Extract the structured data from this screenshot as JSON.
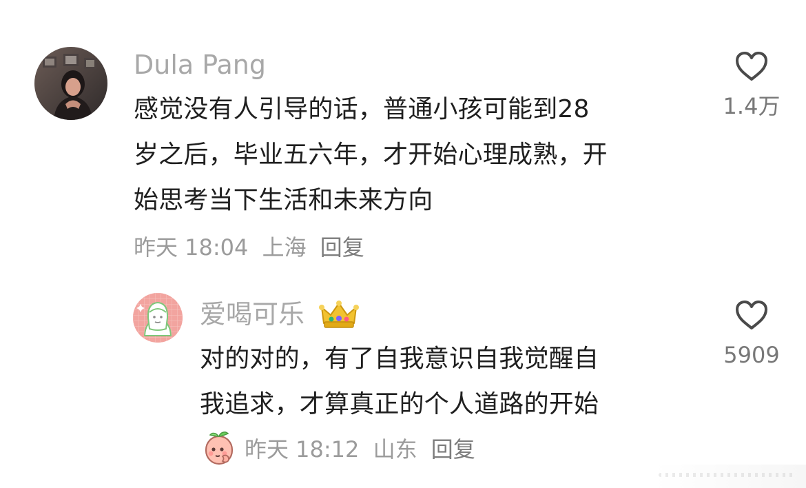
{
  "comments": [
    {
      "user": "Dula Pang",
      "content": "感觉没有人引导的话，普通小孩可能到28\n岁之后，毕业五六年，才开始心理成熟，开\n始思考当下生活和未来方向",
      "time": "昨天 18:04",
      "location": "上海",
      "reply_label": "回复",
      "likes": "1.4万"
    },
    {
      "user": "爱喝可乐",
      "content": "对的对的，有了自我意识自我觉醒自\n我追求，才算真正的个人道路的开始",
      "time": "昨天 18:12",
      "location": "山东",
      "reply_label": "回复",
      "likes": "5909"
    }
  ],
  "colors": {
    "username": "#a8a8a8",
    "text": "#1f1f1f",
    "meta": "#9b9b9b",
    "like_icon": "#4a4a4a"
  },
  "icons": {
    "like": "heart-outline-icon",
    "badge": "crown-icon",
    "sticker": "peach-emoji-sticker-icon"
  }
}
